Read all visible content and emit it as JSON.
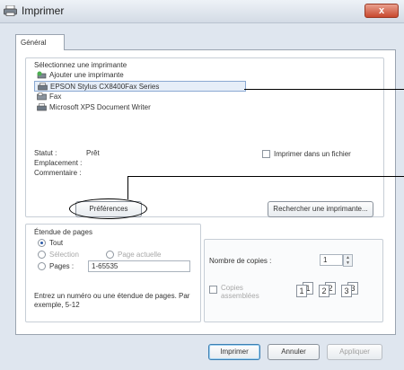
{
  "window": {
    "title": "Imprimer",
    "close_symbol": "x"
  },
  "tabs": [
    {
      "label": "Général"
    }
  ],
  "printer_group": {
    "heading": "Sélectionnez une imprimante",
    "printers": [
      {
        "name": "Ajouter une imprimante",
        "icon": "add-printer-icon"
      },
      {
        "name": "EPSON Stylus CX8400Fax Series",
        "icon": "printer-icon",
        "selected": true
      },
      {
        "name": "Fax",
        "icon": "fax-icon"
      },
      {
        "name": "Microsoft XPS Document Writer",
        "icon": "printer-icon"
      }
    ],
    "status_label": "Statut :",
    "status_value": "Prêt",
    "location_label": "Emplacement :",
    "comment_label": "Commentaire :",
    "print_to_file_label": "Imprimer dans un fichier",
    "preferences_label": "Préférences",
    "find_printer_label": "Rechercher une imprimante..."
  },
  "page_range": {
    "heading": "Étendue de pages",
    "all_label": "Tout",
    "selection_label": "Sélection",
    "current_page_label": "Page actuelle",
    "pages_label": "Pages :",
    "pages_value": "1-65535",
    "hint": "Entrez un numéro ou une étendue de pages. Par exemple, 5-12"
  },
  "copies": {
    "number_label": "Nombre de copies :",
    "number_value": "1",
    "collate_label": "Copies assemblées",
    "collate_pages": [
      "1",
      "1",
      "2",
      "2",
      "3",
      "3"
    ]
  },
  "footer": {
    "print_label": "Imprimer",
    "cancel_label": "Annuler",
    "apply_label": "Appliquer"
  }
}
